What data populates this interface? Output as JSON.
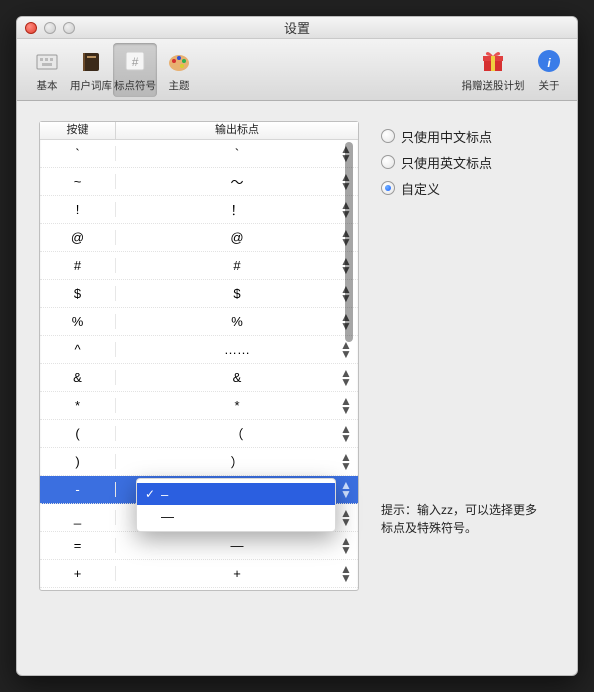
{
  "window": {
    "title": "设置"
  },
  "toolbar": {
    "items": [
      {
        "id": "basic",
        "label": "基本"
      },
      {
        "id": "userdict",
        "label": "用户词库"
      },
      {
        "id": "punct",
        "label": "标点符号"
      },
      {
        "id": "theme",
        "label": "主题"
      }
    ],
    "right": [
      {
        "id": "donate",
        "label": "捐赠送股计划"
      },
      {
        "id": "about",
        "label": "关于"
      }
    ],
    "selected": "punct"
  },
  "table": {
    "headers": {
      "key": "按键",
      "output": "输出标点"
    },
    "rows": [
      {
        "key": "`",
        "output": "`"
      },
      {
        "key": "~",
        "output": "～"
      },
      {
        "key": "!",
        "output": "！"
      },
      {
        "key": "@",
        "output": "@"
      },
      {
        "key": "#",
        "output": "#"
      },
      {
        "key": "$",
        "output": "$"
      },
      {
        "key": "%",
        "output": "%"
      },
      {
        "key": "^",
        "output": "……"
      },
      {
        "key": "&",
        "output": "&"
      },
      {
        "key": "*",
        "output": "*"
      },
      {
        "key": "(",
        "output": "（"
      },
      {
        "key": ")",
        "output": "）"
      },
      {
        "key": "-",
        "output": "–"
      },
      {
        "key": "_",
        "output": "–"
      },
      {
        "key": "=",
        "output": "—"
      },
      {
        "key": "+",
        "output": "+"
      },
      {
        "key": "[",
        "output": ""
      }
    ],
    "selectedRow": 12
  },
  "options": {
    "items": [
      {
        "label": "只使用中文标点",
        "checked": false
      },
      {
        "label": "只使用英文标点",
        "checked": false
      },
      {
        "label": "自定义",
        "checked": true
      }
    ]
  },
  "hint": "提示：输入zz，可以选择更多标点及特殊符号。",
  "popup": {
    "items": [
      {
        "label": "–",
        "selected": true
      },
      {
        "label": "—",
        "selected": false
      }
    ]
  }
}
